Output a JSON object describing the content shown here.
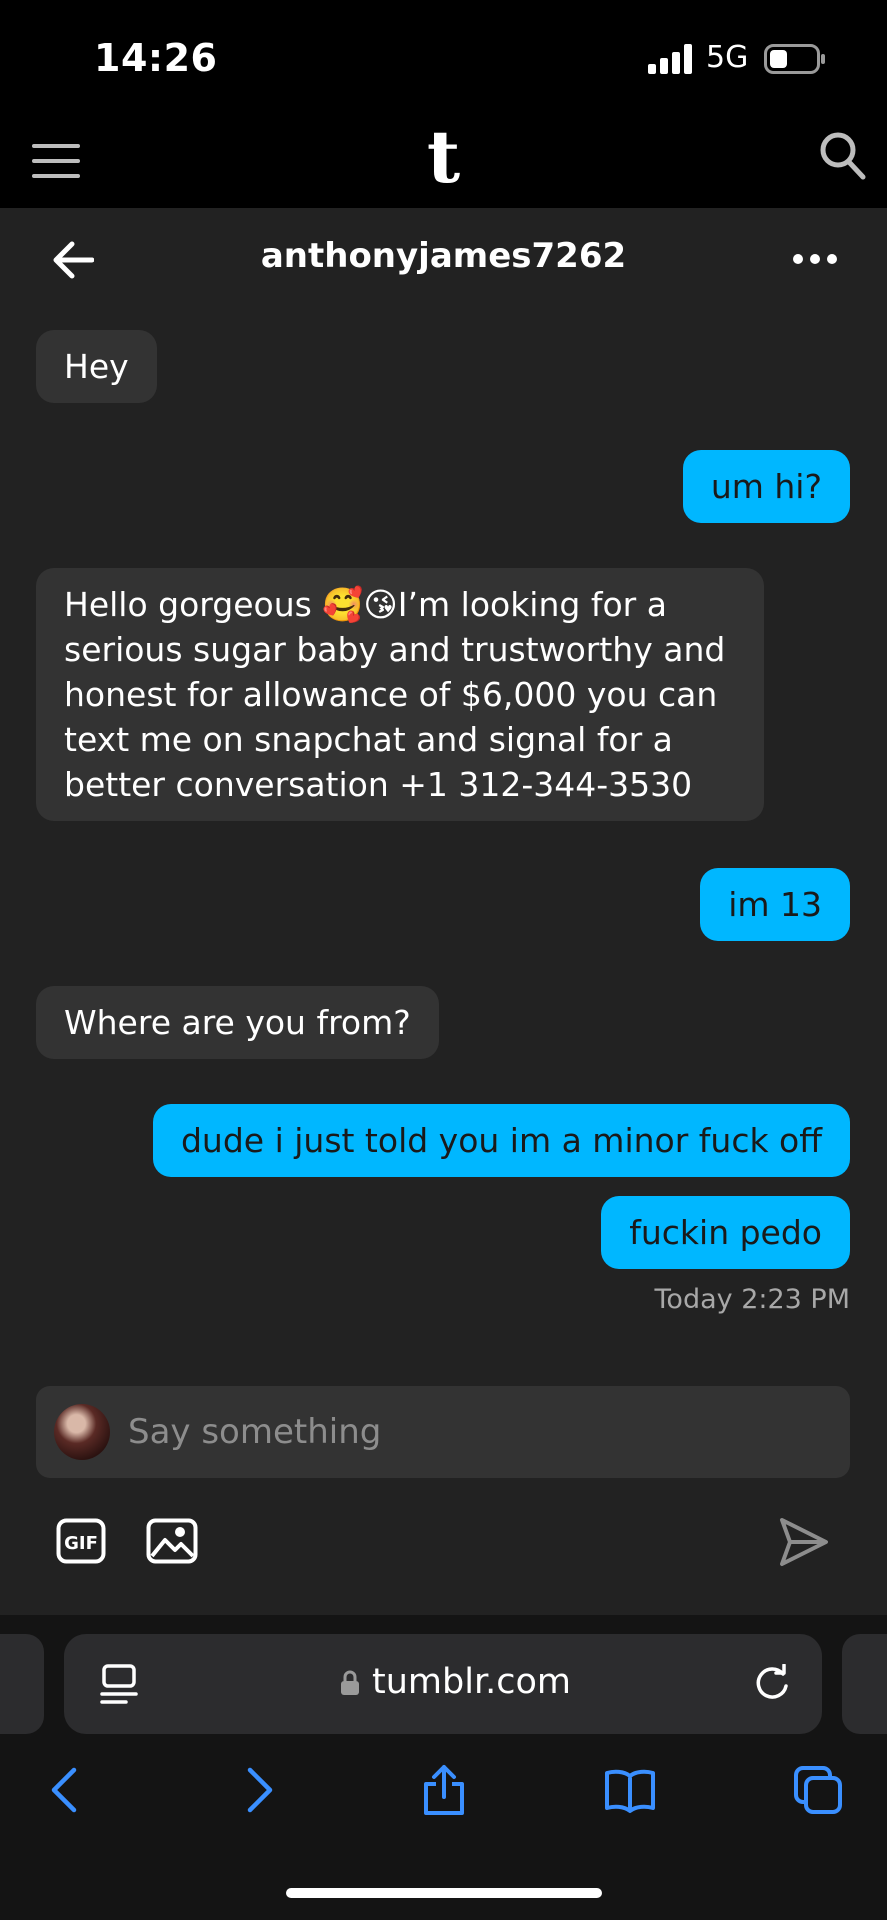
{
  "status_bar": {
    "time": "14:26",
    "network": "5G",
    "battery_level": 0.35
  },
  "header": {
    "logo": "t",
    "menu_icon": "hamburger-menu-icon",
    "search_icon": "search-icon"
  },
  "chat": {
    "title": "anthonyjames7262",
    "messages": [
      {
        "from": "them",
        "text": "Hey"
      },
      {
        "from": "me",
        "text": "um hi?"
      },
      {
        "from": "them",
        "text": "Hello gorgeous 🥰😘I’m looking for a serious sugar baby and trustworthy and honest for allowance of $6,000 you can text me on snapchat and signal for a better conversation +1 312-344-3530"
      },
      {
        "from": "me",
        "text": "im 13"
      },
      {
        "from": "them",
        "text": "Where are you from?"
      },
      {
        "from": "me",
        "text": "dude i just told you im a minor fuck off"
      },
      {
        "from": "me",
        "text": "fuckin pedo"
      }
    ],
    "timestamp": "Today 2:23 PM"
  },
  "composer": {
    "placeholder": "Say something",
    "gif_label": "GIF"
  },
  "browser": {
    "url": "tumblr.com"
  },
  "colors": {
    "outgoing_bubble": "#00b7ff",
    "incoming_bubble": "#333333",
    "chat_bg": "#222222",
    "safari_accent": "#3a8fff"
  }
}
